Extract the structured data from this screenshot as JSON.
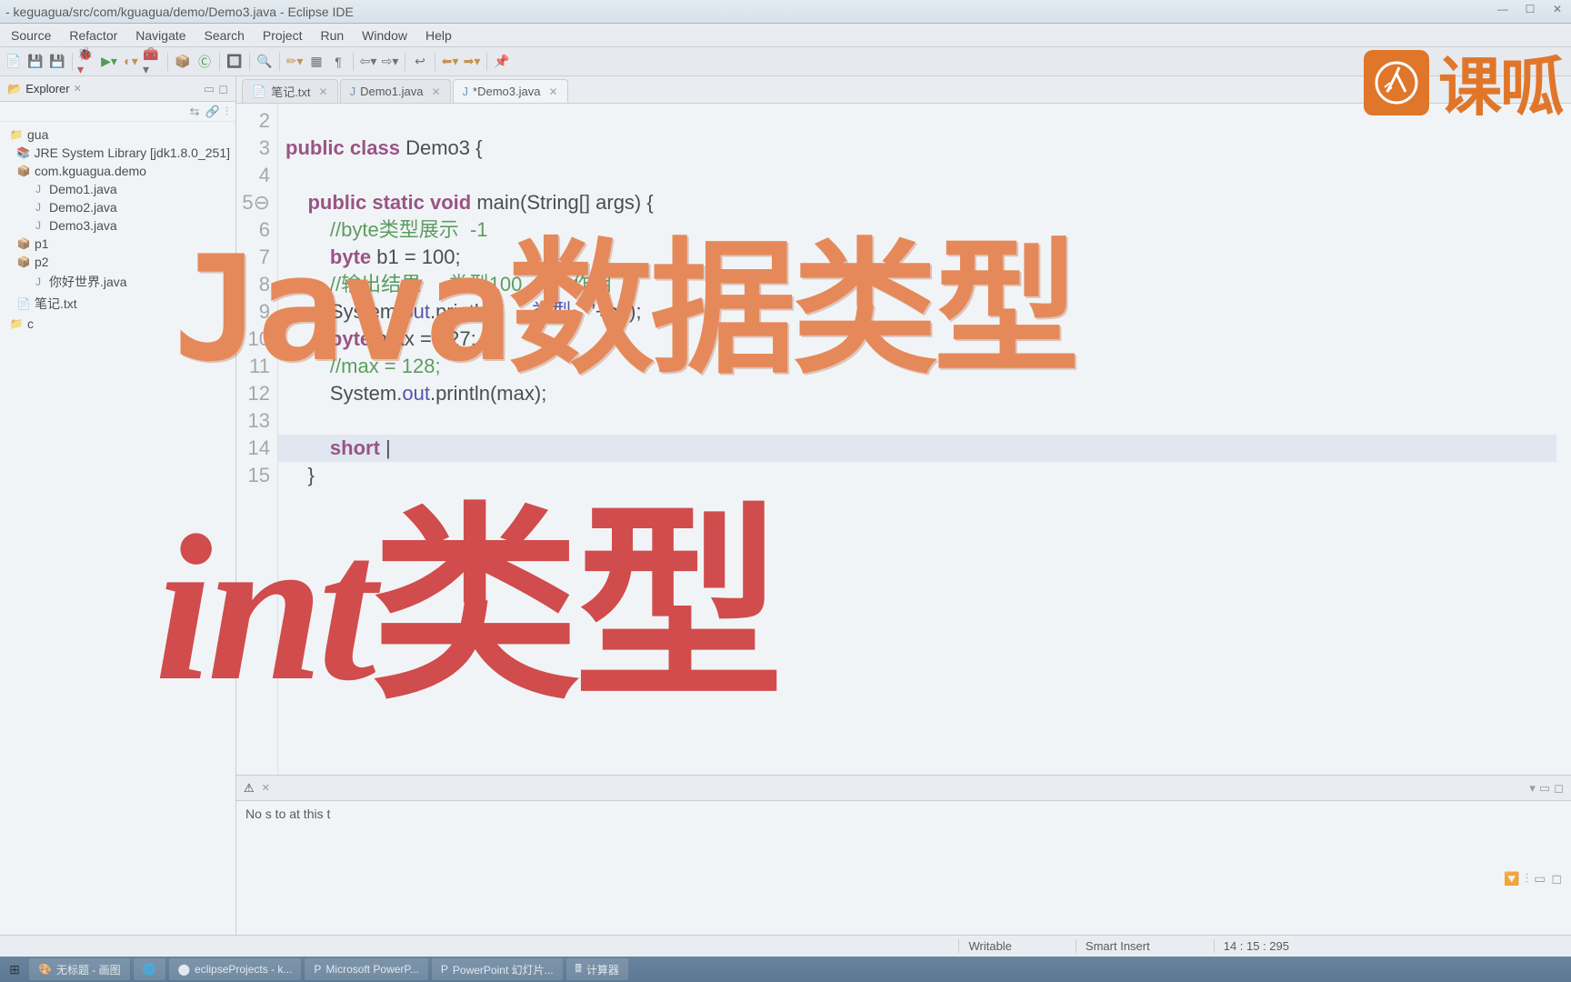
{
  "title": "- keguagua/src/com/kguagua/demo/Demo3.java - Eclipse IDE",
  "menu": [
    "Source",
    "Refactor",
    "Navigate",
    "Search",
    "Project",
    "Run",
    "Window",
    "Help"
  ],
  "explorer": {
    "title": "Explorer",
    "nodes": [
      {
        "label": "gua",
        "lvl": 0,
        "icon": "📁"
      },
      {
        "label": "JRE System Library [jdk1.8.0_251]",
        "lvl": 1,
        "icon": "📚"
      },
      {
        "label": "com.kguagua.demo",
        "lvl": 1,
        "icon": "📦"
      },
      {
        "label": "Demo1.java",
        "lvl": 2,
        "icon": "J"
      },
      {
        "label": "Demo2.java",
        "lvl": 2,
        "icon": "J"
      },
      {
        "label": "Demo3.java",
        "lvl": 2,
        "icon": "J"
      },
      {
        "label": "p1",
        "lvl": 1,
        "icon": "📦"
      },
      {
        "label": "p2",
        "lvl": 1,
        "icon": "📦"
      },
      {
        "label": "你好世界.java",
        "lvl": 2,
        "icon": "J"
      },
      {
        "label": "笔记.txt",
        "lvl": 1,
        "icon": "📄"
      },
      {
        "label": "c",
        "lvl": 0,
        "icon": "📁"
      }
    ]
  },
  "tabs": [
    {
      "label": "笔记.txt",
      "icon": "📄",
      "active": false
    },
    {
      "label": "Demo1.java",
      "icon": "J",
      "active": false
    },
    {
      "label": "*Demo3.java",
      "icon": "J",
      "active": true
    }
  ],
  "code": {
    "start": 2,
    "lines": [
      {
        "n": "2",
        "html": ""
      },
      {
        "n": "3",
        "html": "<span class='kw'>public</span> <span class='kw'>class</span> Demo3 {"
      },
      {
        "n": "4",
        "html": ""
      },
      {
        "n": "5⊖",
        "html": "    <span class='kw'>public</span> <span class='kw'>static</span> <span class='kw'>void</span> main(String[] args) {"
      },
      {
        "n": "6",
        "html": "        <span class='com'>//byte类型展示  -1</span>"
      },
      {
        "n": "7",
        "html": "        <span class='kw'>byte</span> b1 = 100;"
      },
      {
        "n": "8",
        "html": "        <span class='com'>//输出结果     类型100         作用</span>"
      },
      {
        "n": "9",
        "html": "        System.<span class='fld'>out</span>.println(<span class='str'>&quot;     类型   &quot;</span>+b1);"
      },
      {
        "n": "10",
        "html": "        <span class='kw'>byte</span> max = 127;"
      },
      {
        "n": "11",
        "html": "        <span class='com'>//max = 128;</span>"
      },
      {
        "n": "12",
        "html": "        System.<span class='fld'>out</span>.println(max);"
      },
      {
        "n": "13",
        "html": ""
      },
      {
        "n": "14",
        "html": "        <span class='kw'>short</span> |",
        "hl": true
      },
      {
        "n": "15",
        "html": "    }"
      }
    ]
  },
  "problems": {
    "tab": "",
    "text": "No         s to       at this t"
  },
  "status": {
    "writable": "Writable",
    "insert": "Smart Insert",
    "pos": "14 : 15 : 295"
  },
  "taskbar": [
    {
      "label": "无标题 - 画图",
      "icon": "🎨"
    },
    {
      "label": "",
      "icon": "🌐"
    },
    {
      "label": "eclipseProjects - k...",
      "icon": "⬤"
    },
    {
      "label": "Microsoft PowerP...",
      "icon": "P"
    },
    {
      "label": "PowerPoint 幻灯片...",
      "icon": "P"
    },
    {
      "label": "计算器",
      "icon": "🖩"
    }
  ],
  "brand": {
    "text": "课呱"
  },
  "overlay1": {
    "java": "Java",
    "rest": "数据类型"
  },
  "overlay2": {
    "ital": "int",
    "rest": "类型"
  }
}
